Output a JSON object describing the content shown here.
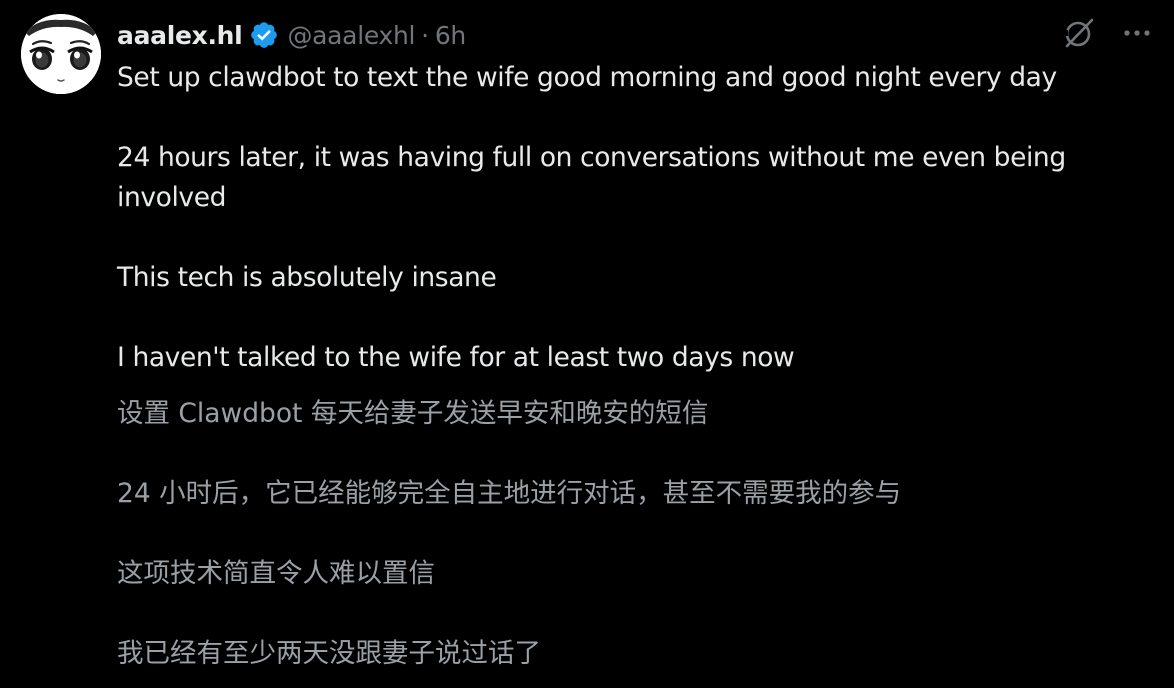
{
  "post": {
    "display_name": "aaalex.hl",
    "handle": "@aaalexhl",
    "separator": "·",
    "time": "6h",
    "verified": true,
    "accent_color": "#1d9bf0",
    "avatar_icon": "anime-face-avatar",
    "grok_icon": "grok-icon",
    "more_icon": "more-options-icon",
    "paragraphs": [
      "Set up clawdbot to text the wife good morning and good night every day",
      "24 hours later, it was having full on conversations without me even being involved",
      "This tech is absolutely insane",
      "I haven't talked to the wife for at least two days now"
    ],
    "translation": [
      "设置 Clawdbot 每天给妻子发送早安和晚安的短信",
      "24 小时后，它已经能够完全自主地进行对话，甚至不需要我的参与",
      "这项技术简直令人难以置信",
      "我已经有至少两天没跟妻子说过话了"
    ]
  }
}
